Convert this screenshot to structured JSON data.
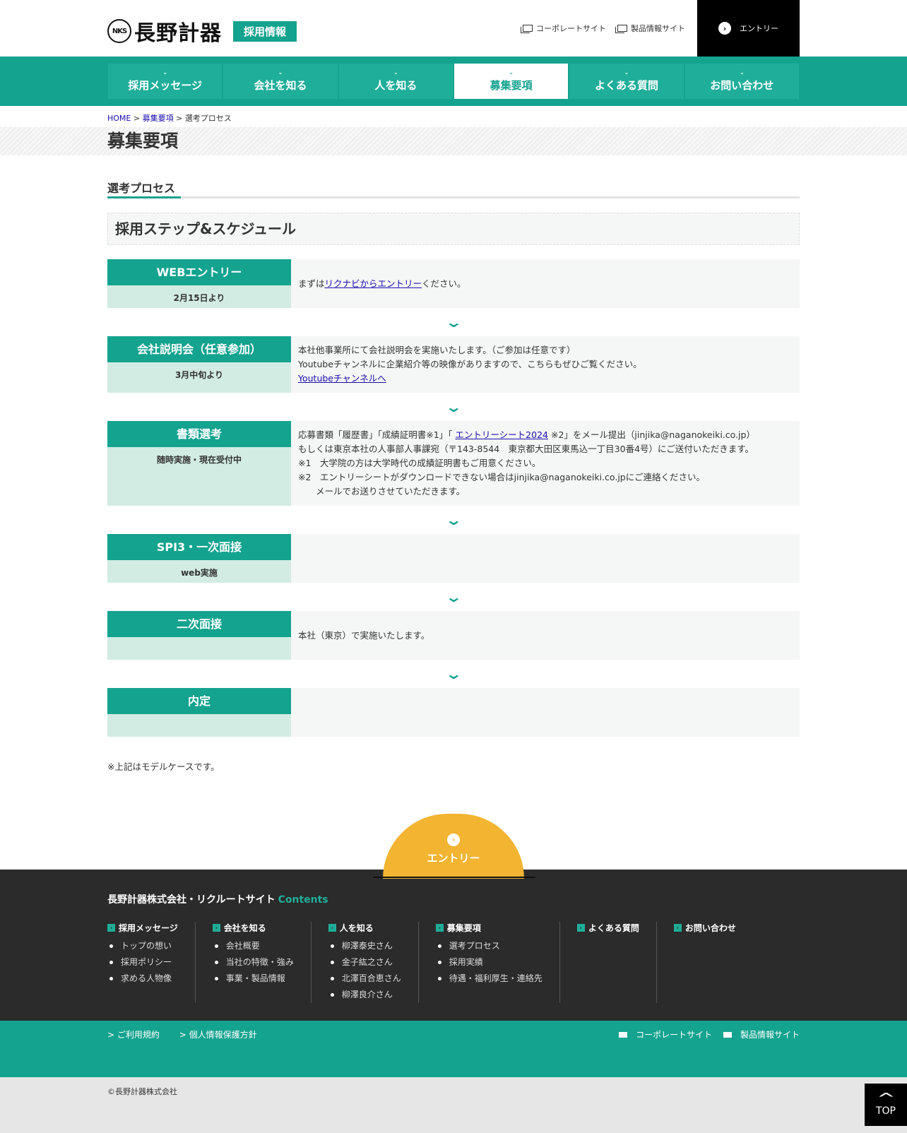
{
  "header": {
    "logo_mark": "NKS",
    "logo_text": "長野計器",
    "badge": "採用情報",
    "links": [
      "コーポレートサイト",
      "製品情報サイト"
    ],
    "entry_label": "エントリー"
  },
  "nav": {
    "items": [
      "採用メッセージ",
      "会社を知る",
      "人を知る",
      "募集要項",
      "よくある質問",
      "お問い合わせ"
    ],
    "active_index": 3
  },
  "breadcrumb": {
    "home": "HOME",
    "sep": ">",
    "parent": "募集要項",
    "current": "選考プロセス"
  },
  "page_title": "募集要項",
  "section_title": "選考プロセス",
  "step_heading": "採用ステップ&スケジュール",
  "steps": [
    {
      "name": "WEBエントリー",
      "date": "2月15日より",
      "text_before": "まずは",
      "link": "リクナビからエントリー",
      "text_after": "ください。"
    },
    {
      "name": "会社説明会（任意参加）",
      "date": "3月中旬より",
      "line1": "本社他事業所にて会社説明会を実施いたします。（ご参加は任意です）",
      "line2": "Youtubeチャンネルに企業紹介等の映像がありますので、こちらもぜひご覧ください。",
      "link": "Youtubeチャンネルへ"
    },
    {
      "name": "書類選考",
      "date": "随時実施・現在受付中",
      "line1_before": "応募書類「履歴書」「成績証明書※1」「",
      "link": "エントリーシート2024",
      "line1_after": "※2」をメール提出（jinjika@naganokeiki.co.jp）",
      "line2": "もしくは東京本社の人事部人事課宛（〒143-8544　東京都大田区東馬込一丁目30番4号）にご送付いただきます。",
      "line3": "※1　大学院の方は大学時代の成績証明書もご用意ください。",
      "line4": "※2　エントリーシートがダウンロードできない場合はjinjika@naganokeiki.co.jpにご連絡ください。",
      "line5": "　　メールでお送りさせていただきます。"
    },
    {
      "name": "SPI3・一次面接",
      "date": "web実施"
    },
    {
      "name": "二次面接",
      "date": "",
      "text": "本社（東京）で実施いたします。"
    },
    {
      "name": "内定",
      "date": ""
    }
  ],
  "note": "※上記はモデルケースです。",
  "footer": {
    "entry_label": "エントリー",
    "site_name": "長野計器株式会社・リクルートサイト",
    "contents": "Contents",
    "columns": [
      {
        "title": "採用メッセージ",
        "items": [
          "トップの想い",
          "採用ポリシー",
          "求める人物像"
        ]
      },
      {
        "title": "会社を知る",
        "items": [
          "会社概要",
          "当社の特徴・強み",
          "事業・製品情報"
        ]
      },
      {
        "title": "人を知る",
        "items": [
          "柳澤泰史さん",
          "金子紘之さん",
          "北澤百合恵さん",
          "柳澤良介さん"
        ]
      },
      {
        "title": "募集要項",
        "items": [
          "選考プロセス",
          "採用実績",
          "待遇・福利厚生・連絡先"
        ]
      },
      {
        "title": "よくある質問",
        "items": []
      },
      {
        "title": "お問い合わせ",
        "items": []
      }
    ],
    "bottom_links": [
      "ご利用規約",
      "個人情報保護方針"
    ],
    "bottom_right_links": [
      "コーポレートサイト",
      "製品情報サイト"
    ],
    "copyright": "©長野計器株式会社",
    "top_label": "TOP"
  },
  "colors": {
    "accent": "#14a38f",
    "entry": "#f2b431",
    "step_date_bg": "#d2ece3"
  }
}
